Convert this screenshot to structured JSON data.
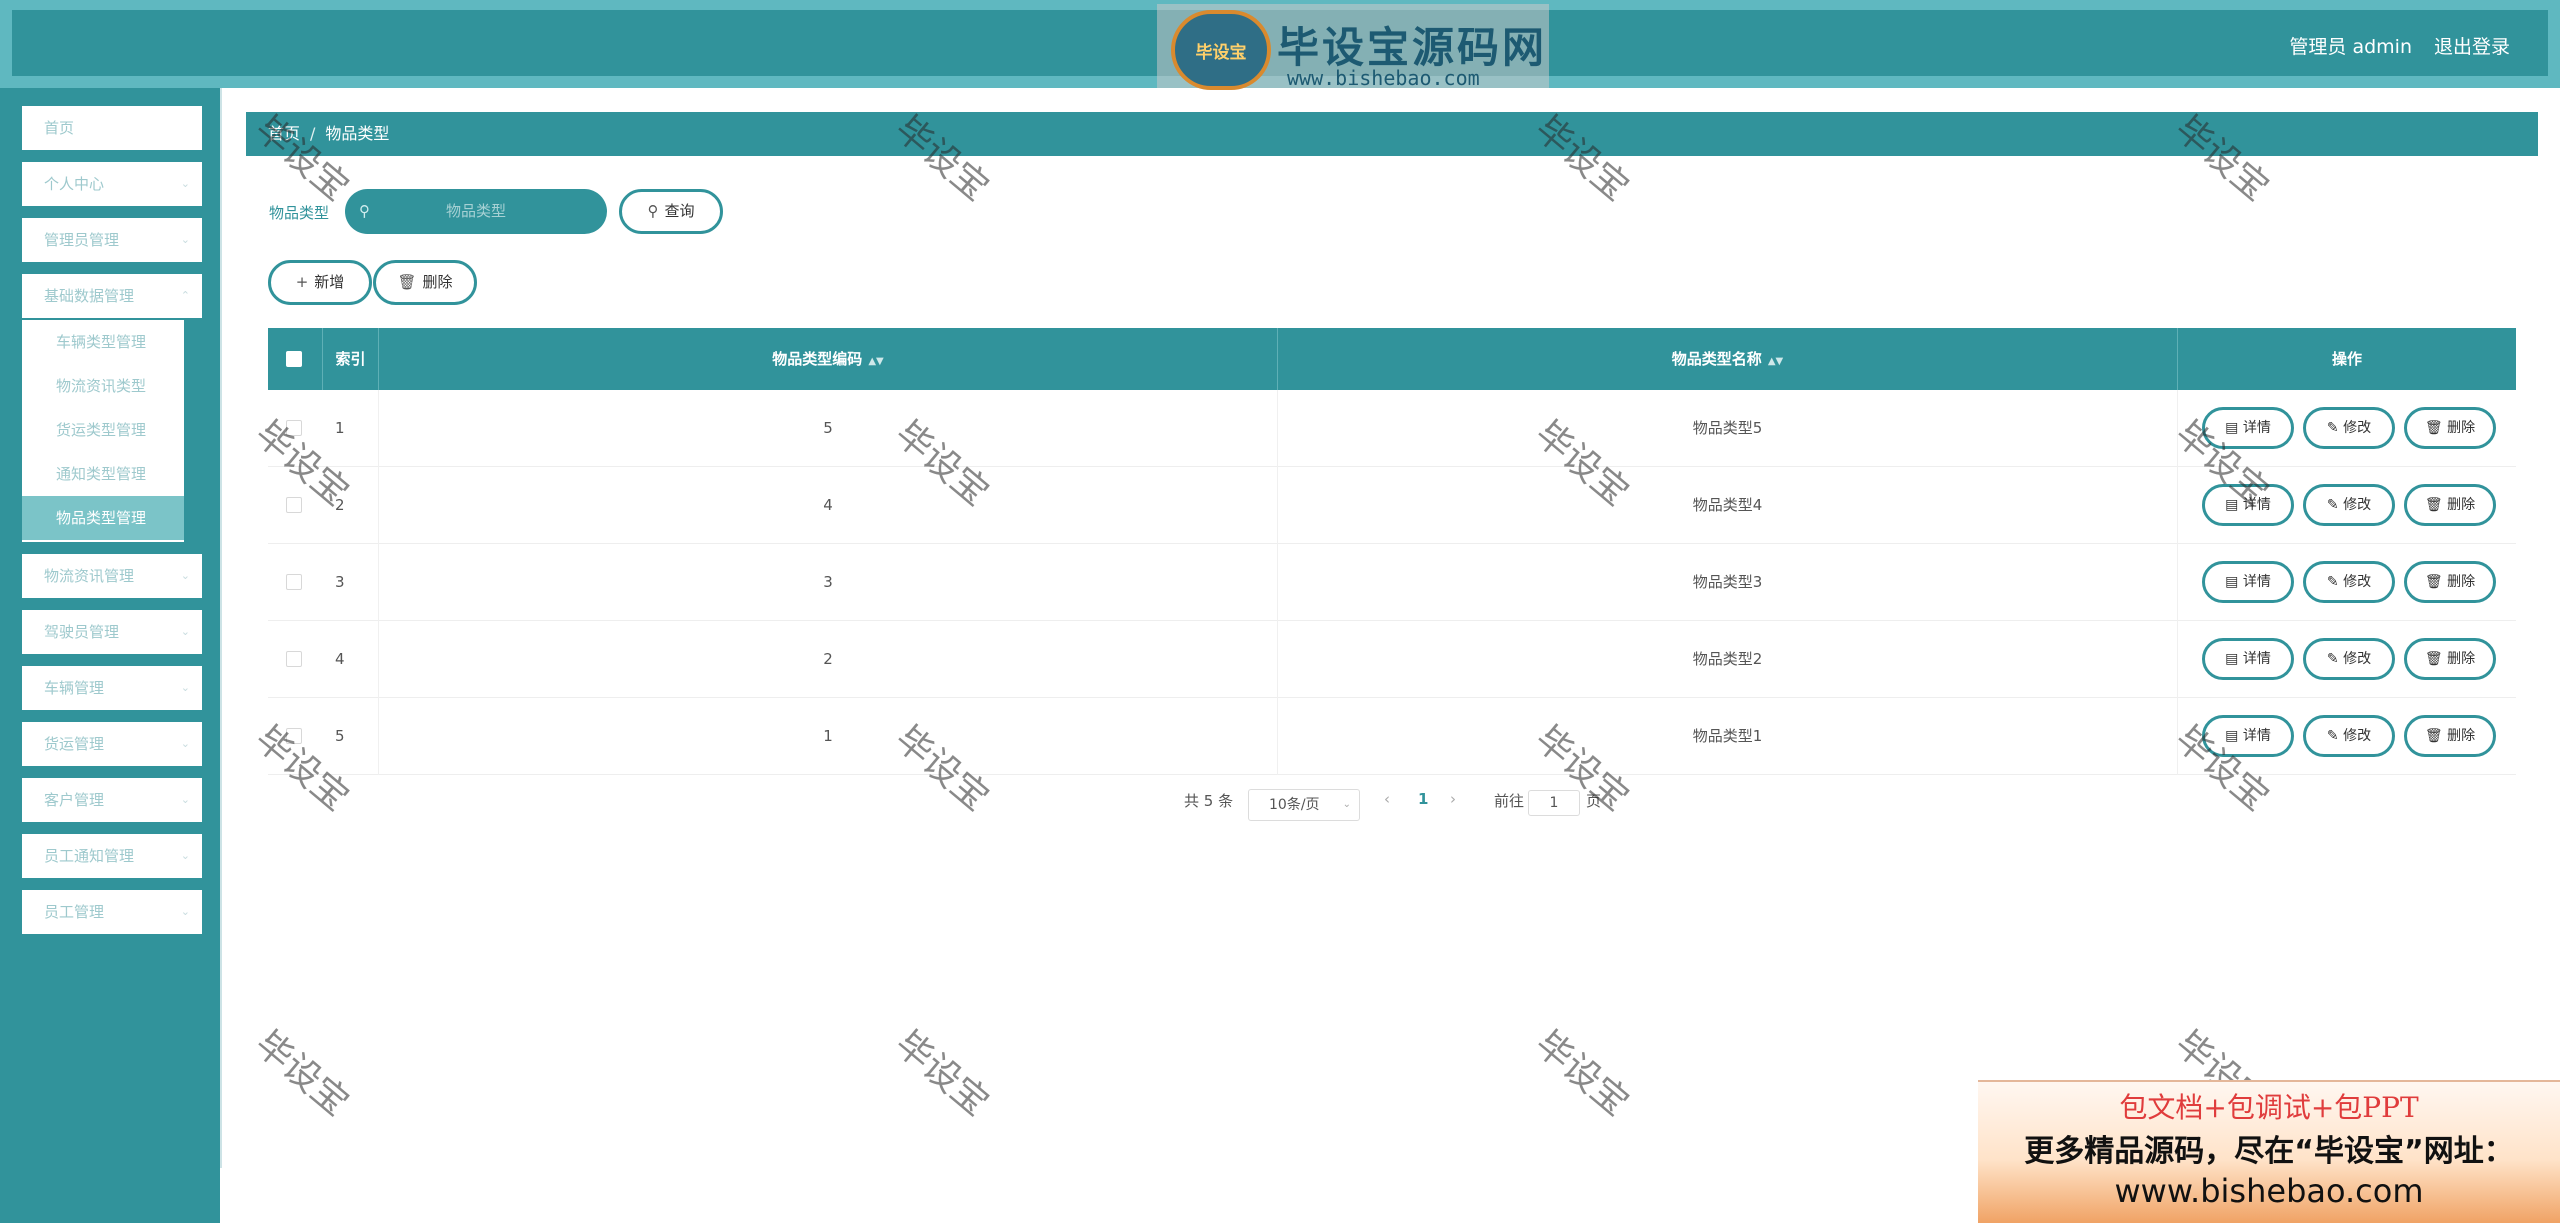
{
  "header": {
    "logo_badge": "毕设宝",
    "logo_title": "毕设宝源码网",
    "logo_url": "www.bishebao.com",
    "user": "管理员 admin",
    "logout": "退出登录"
  },
  "sidebar": {
    "items_top": [
      {
        "label": "首页"
      },
      {
        "label": "个人中心"
      },
      {
        "label": "管理员管理"
      },
      {
        "label": "基础数据管理"
      }
    ],
    "submenu": [
      {
        "label": "车辆类型管理"
      },
      {
        "label": "物流资讯类型"
      },
      {
        "label": "货运类型管理"
      },
      {
        "label": "通知类型管理"
      },
      {
        "label": "物品类型管理"
      }
    ],
    "items_bottom": [
      {
        "label": "物流资讯管理"
      },
      {
        "label": "驾驶员管理"
      },
      {
        "label": "车辆管理"
      },
      {
        "label": "货运管理"
      },
      {
        "label": "客户管理"
      },
      {
        "label": "员工通知管理"
      },
      {
        "label": "员工管理"
      }
    ]
  },
  "breadcrumb": {
    "home": "首页",
    "sep": "/",
    "current": "物品类型"
  },
  "search": {
    "label": "物品类型",
    "placeholder": "物品类型",
    "query_button": "查询"
  },
  "actions": {
    "add": "新增",
    "delete": "删除"
  },
  "table": {
    "columns": {
      "index": "索引",
      "code": "物品类型编码",
      "name": "物品类型名称",
      "ops": "操作"
    },
    "row_buttons": {
      "detail": "详情",
      "edit": "修改",
      "delete": "删除"
    },
    "rows": [
      {
        "index": "1",
        "code": "5",
        "name": "物品类型5"
      },
      {
        "index": "2",
        "code": "4",
        "name": "物品类型4"
      },
      {
        "index": "3",
        "code": "3",
        "name": "物品类型3"
      },
      {
        "index": "4",
        "code": "2",
        "name": "物品类型2"
      },
      {
        "index": "5",
        "code": "1",
        "name": "物品类型1"
      }
    ]
  },
  "pagination": {
    "total": "共 5 条",
    "page_size": "10条/页",
    "current_page": "1",
    "goto_label": "前往",
    "goto_value": "1",
    "page_unit": "页"
  },
  "watermark": "毕设宝",
  "ad": {
    "line1": "包文档+包调试+包PPT",
    "line2": "更多精品源码，尽在“毕设宝”网址：",
    "line3": "www.bishebao.com"
  },
  "colors": {
    "primary": "#31939b",
    "header_outer": "#5fb8c0",
    "accent_light": "#7bc4c8"
  },
  "icons": {
    "search": "search-icon",
    "plus": "plus-icon",
    "trash": "trash-icon",
    "doc": "document-icon",
    "pencil": "edit-icon",
    "chevron": "chevron-down-icon",
    "sort": "sort-icon"
  }
}
